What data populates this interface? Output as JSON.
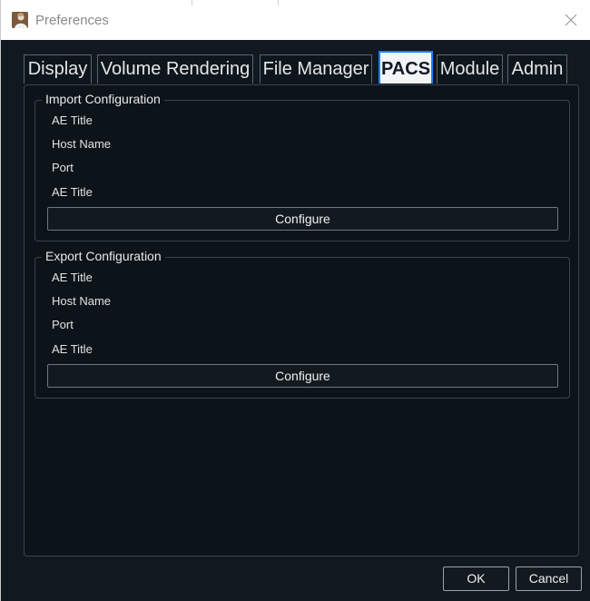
{
  "window": {
    "title": "Preferences"
  },
  "tabs": [
    {
      "label": "Display"
    },
    {
      "label": "Volume Rendering"
    },
    {
      "label": "File Manager"
    },
    {
      "label": "PACS",
      "active": true
    },
    {
      "label": "Module"
    },
    {
      "label": "Admin"
    }
  ],
  "import_config": {
    "title": "Import Configuration",
    "fields": [
      "AE Title",
      "Host Name",
      "Port",
      "AE Title"
    ],
    "configure_label": "Configure"
  },
  "export_config": {
    "title": "Export Configuration",
    "fields": [
      "AE Title",
      "Host Name",
      "Port",
      "AE Title"
    ],
    "configure_label": "Configure"
  },
  "footer": {
    "ok_label": "OK",
    "cancel_label": "Cancel"
  },
  "icons": {
    "app": "app-portrait-icon",
    "close": "close-icon"
  },
  "colors": {
    "background": "#101820",
    "active_tab_border": "#1d80ff"
  }
}
